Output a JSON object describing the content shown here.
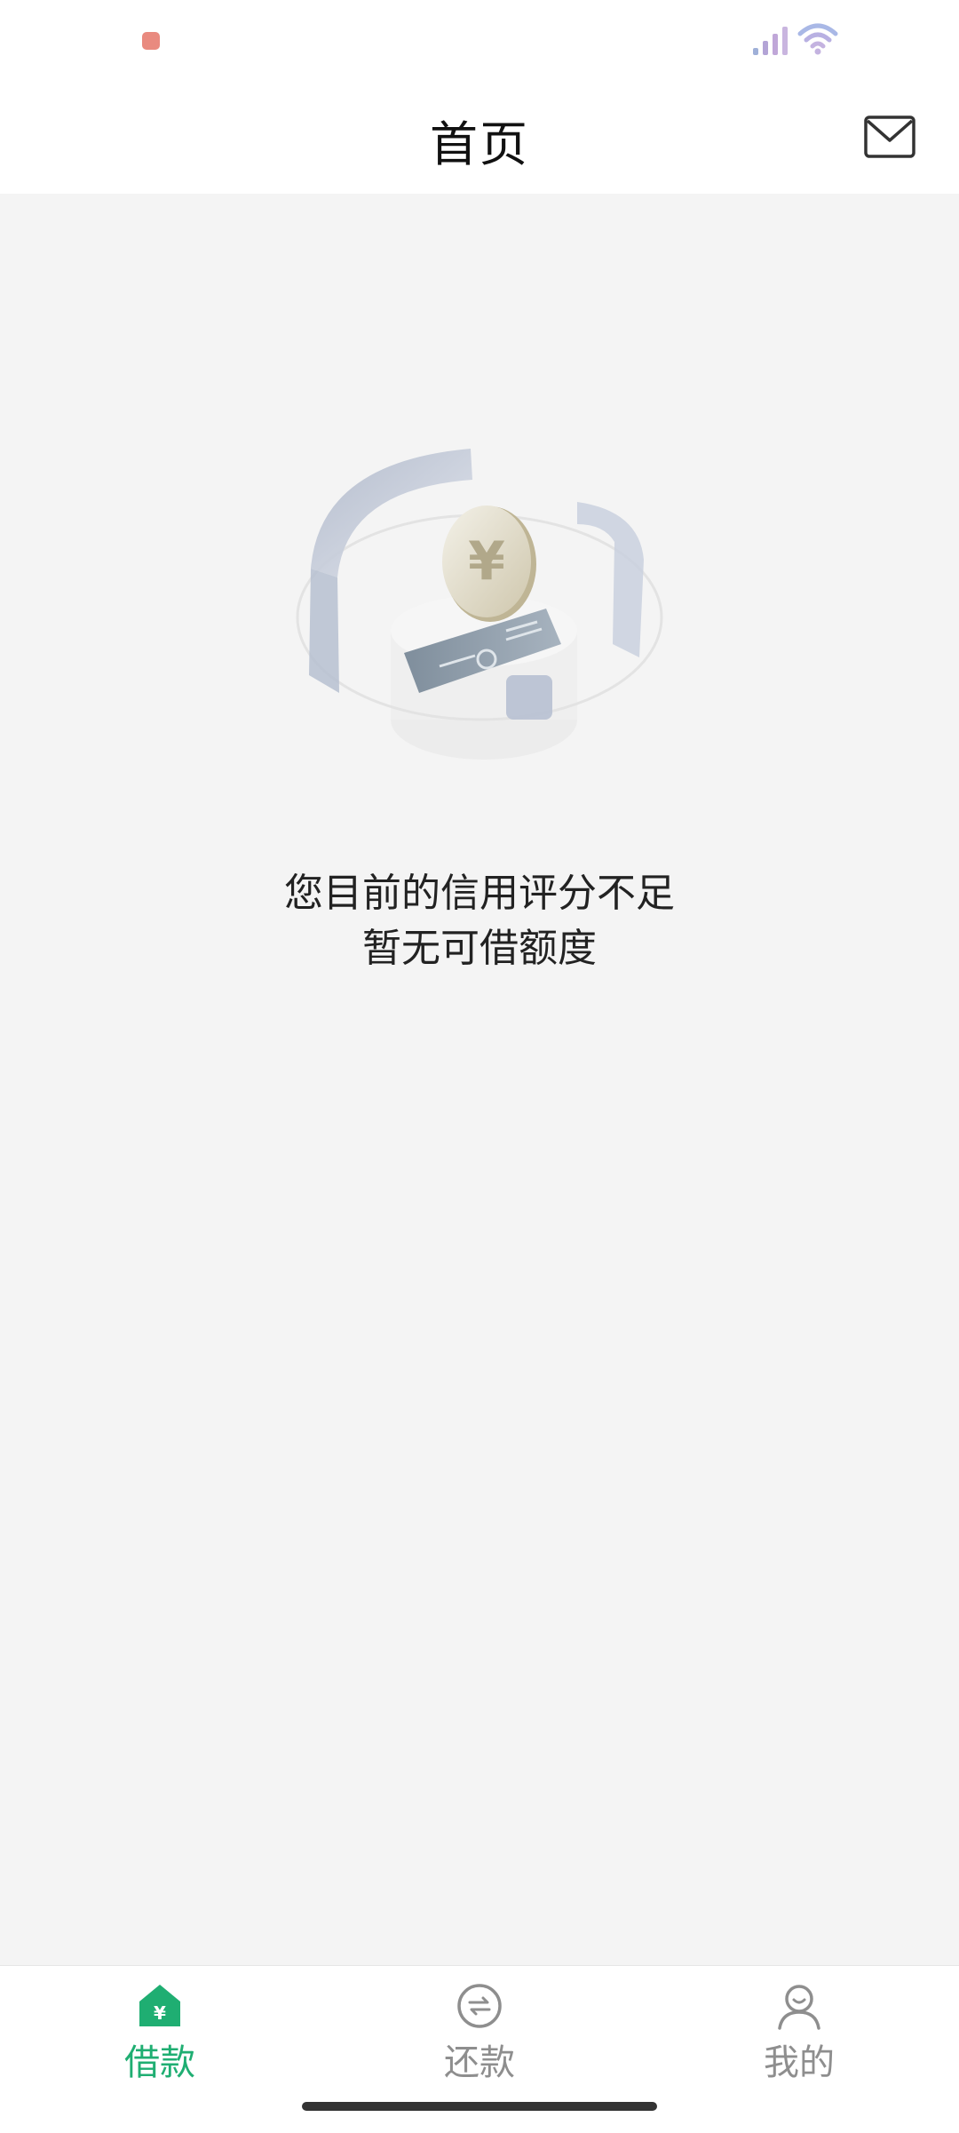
{
  "header": {
    "title": "首页"
  },
  "empty_state": {
    "line1": "您目前的信用评分不足",
    "line2": "暂无可借额度"
  },
  "tabs": [
    {
      "label": "借款",
      "icon": "yuan-home-icon",
      "active": true
    },
    {
      "label": "还款",
      "icon": "repay-exchange-icon",
      "active": false
    },
    {
      "label": "我的",
      "icon": "user-profile-icon",
      "active": false
    }
  ],
  "colors": {
    "accent": "#1fae72",
    "inactive": "#8e8e8e",
    "background": "#f4f4f4"
  }
}
